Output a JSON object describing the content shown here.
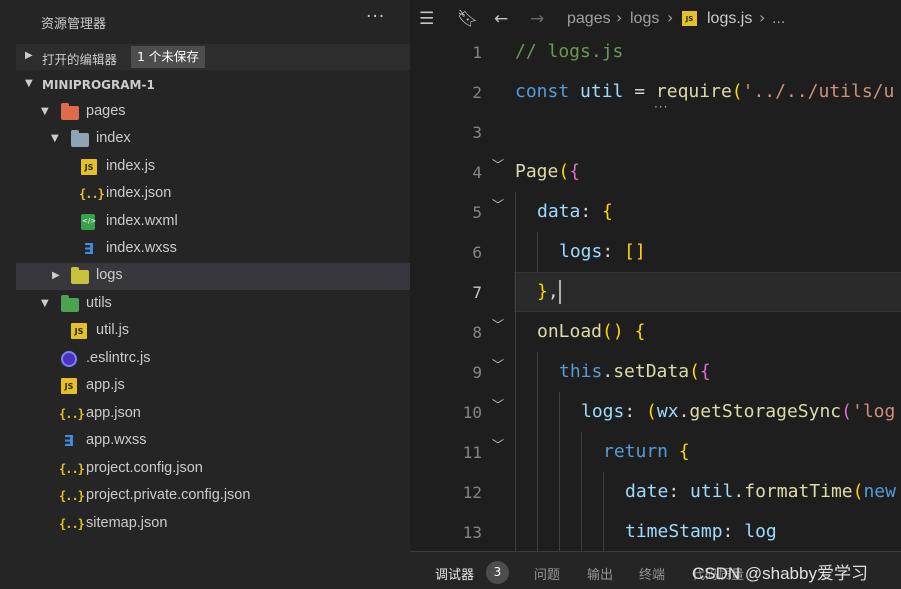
{
  "sidebar": {
    "title": "资源管理器",
    "more": "···",
    "open_editors": {
      "label": "打开的编辑器",
      "badge": "1 个未保存"
    },
    "project": {
      "label": "MINIPROGRAM-1"
    },
    "tree": [
      {
        "name": "pages",
        "type": "folder",
        "icon": "folder-pages-icon",
        "expanded": true
      },
      {
        "name": "index",
        "type": "folder",
        "icon": "folder-icon",
        "expanded": true
      },
      {
        "name": "index.js",
        "type": "js",
        "icon": "js-file-icon"
      },
      {
        "name": "index.json",
        "type": "json",
        "icon": "json-file-icon"
      },
      {
        "name": "index.wxml",
        "type": "wxml",
        "icon": "wxml-file-icon"
      },
      {
        "name": "index.wxss",
        "type": "wxss",
        "icon": "wxss-file-icon"
      },
      {
        "name": "logs",
        "type": "folder",
        "icon": "folder-logs-icon",
        "expanded": false,
        "selected": true
      },
      {
        "name": "utils",
        "type": "folder",
        "icon": "folder-utils-icon",
        "expanded": true
      },
      {
        "name": "util.js",
        "type": "js",
        "icon": "js-file-icon"
      },
      {
        "name": ".eslintrc.js",
        "type": "eslint",
        "icon": "eslint-icon"
      },
      {
        "name": "app.js",
        "type": "js",
        "icon": "js-file-icon"
      },
      {
        "name": "app.json",
        "type": "json",
        "icon": "json-file-icon"
      },
      {
        "name": "app.wxss",
        "type": "wxss",
        "icon": "wxss-file-icon"
      },
      {
        "name": "project.config.json",
        "type": "json",
        "icon": "json-file-icon"
      },
      {
        "name": "project.private.config.json",
        "type": "json",
        "icon": "json-file-icon"
      },
      {
        "name": "sitemap.json",
        "type": "json",
        "icon": "json-file-icon"
      }
    ]
  },
  "editor": {
    "breadcrumb": {
      "icons": [
        "list-icon",
        "bookmark-icon",
        "back-arrow-icon",
        "forward-arrow-icon"
      ],
      "items": [
        "pages",
        "logs",
        "logs.js",
        "..."
      ],
      "file_icon_text": "JS"
    },
    "lines": [
      {
        "num": "1",
        "text": "// logs.js"
      },
      {
        "num": "2",
        "text": "const util = require('../../utils/u"
      },
      {
        "num": "3",
        "text": ""
      },
      {
        "num": "4",
        "text": "Page({"
      },
      {
        "num": "5",
        "text": "data: {"
      },
      {
        "num": "6",
        "text": "logs: []"
      },
      {
        "num": "7",
        "text": "},"
      },
      {
        "num": "8",
        "text": "onLoad() {"
      },
      {
        "num": "9",
        "text": "this.setData({"
      },
      {
        "num": "10",
        "text": "logs: (wx.getStorageSync('log"
      },
      {
        "num": "11",
        "text": "return {"
      },
      {
        "num": "12",
        "text": "date: util.formatTime(new"
      },
      {
        "num": "13",
        "text": "timeStamp: log"
      }
    ],
    "current_line": "7",
    "hint_dots": "···"
  },
  "panel": {
    "tabs": [
      "调试器",
      "问题",
      "输出",
      "终端",
      "代码质量"
    ],
    "badge": "3",
    "watermark": "CSDN @shabby爱学习"
  },
  "colors": {
    "sidebar_bg": "#252526",
    "editor_bg": "#1e1e1e",
    "comment": "#6a9955",
    "keyword": "#569cd6",
    "function": "#dcdcaa",
    "string": "#ce9178",
    "property": "#9cdcfe",
    "bracket_gold": "#ffd700",
    "bracket_pink": "#da70d6",
    "bracket_blue": "#179fff"
  }
}
